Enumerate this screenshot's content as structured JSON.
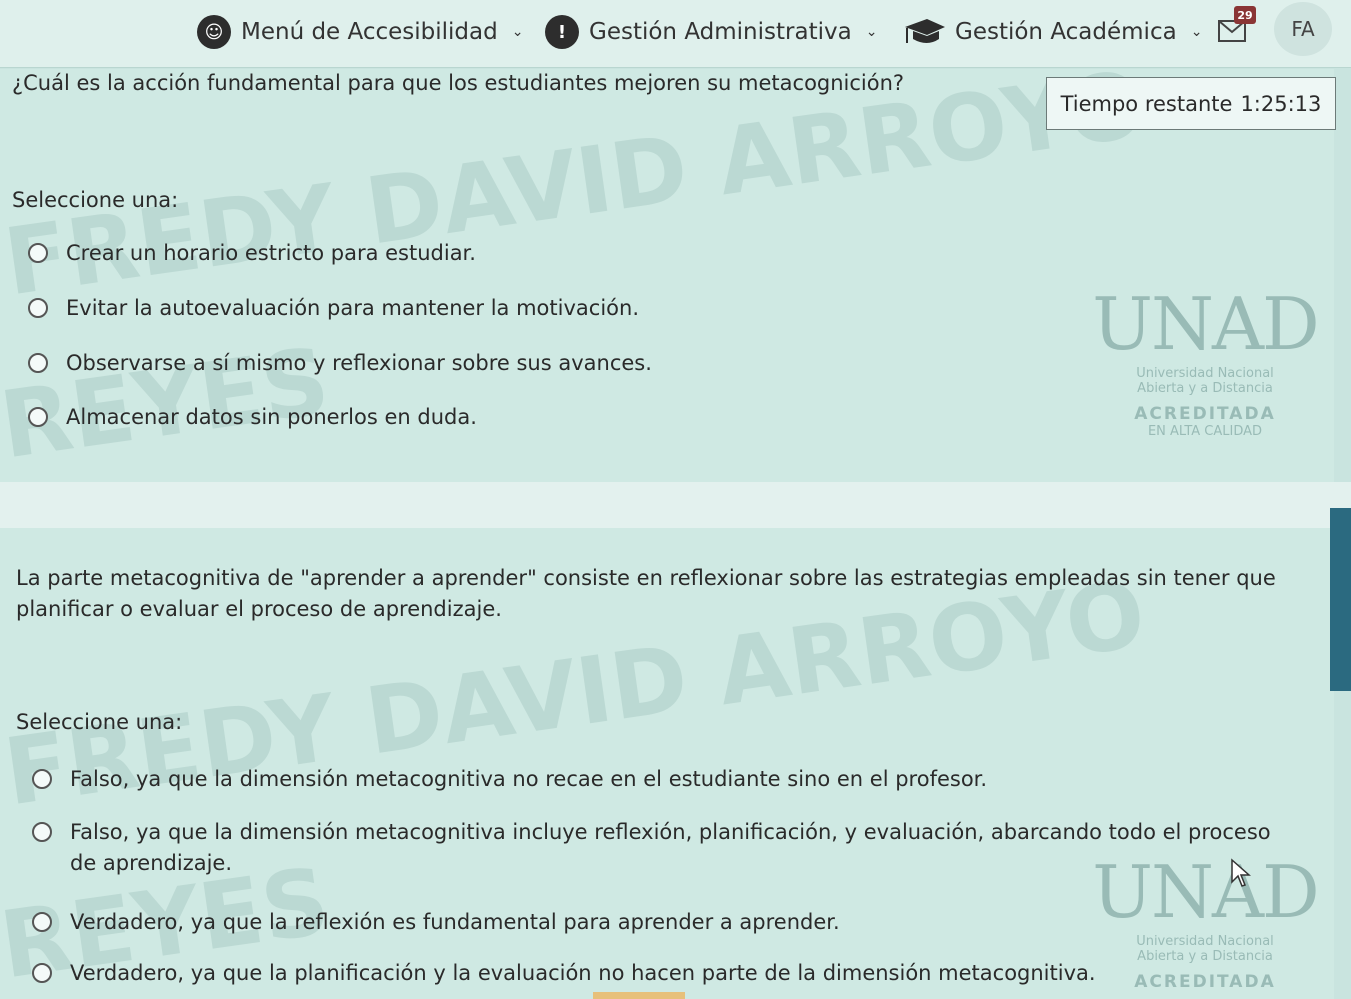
{
  "nav": {
    "accessibility": "Menú de Accesibilidad",
    "admin": "Gestión Administrativa",
    "academic": "Gestión Académica",
    "mail_badge": "29",
    "avatar": "FA"
  },
  "timer": {
    "label": "Tiempo restante",
    "value": "1:25:13"
  },
  "q1": {
    "text": "¿Cuál es la acción fundamental para que los estudiantes mejoren su metacognición?",
    "select_label": "Seleccione una:",
    "options": [
      "Crear un horario estricto para estudiar.",
      "Evitar la autoevaluación para mantener la motivación.",
      "Observarse a sí mismo y reflexionar sobre sus avances.",
      "Almacenar datos sin ponerlos en duda."
    ]
  },
  "q2": {
    "text_line1": "La parte metacognitiva de \"aprender a aprender\" consiste en reflexionar sobre las estrategias empleadas sin tener que",
    "text_line2": "planificar o evaluar el proceso de aprendizaje.",
    "select_label": "Seleccione una:",
    "options": [
      "Falso, ya que la dimensión metacognitiva no recae en el estudiante sino en el profesor.",
      "Falso, ya que la dimensión metacognitiva incluye reflexión, planificación, y evaluación, abarcando todo el proceso de aprendizaje.",
      "Verdadero, ya que la reflexión es fundamental para aprender a aprender.",
      "Verdadero, ya que la planificación y la evaluación no hacen parte de la dimensión metacognitiva."
    ]
  },
  "watermark": {
    "line1": "FREDY DAVID ARROYO",
    "line2": "REYES"
  },
  "logo": {
    "mark": "UNAD",
    "line1": "Universidad Nacional",
    "line2": "Abierta y a Distancia",
    "line3": "ACREDITADA",
    "line4": "EN ALTA CALIDAD"
  }
}
